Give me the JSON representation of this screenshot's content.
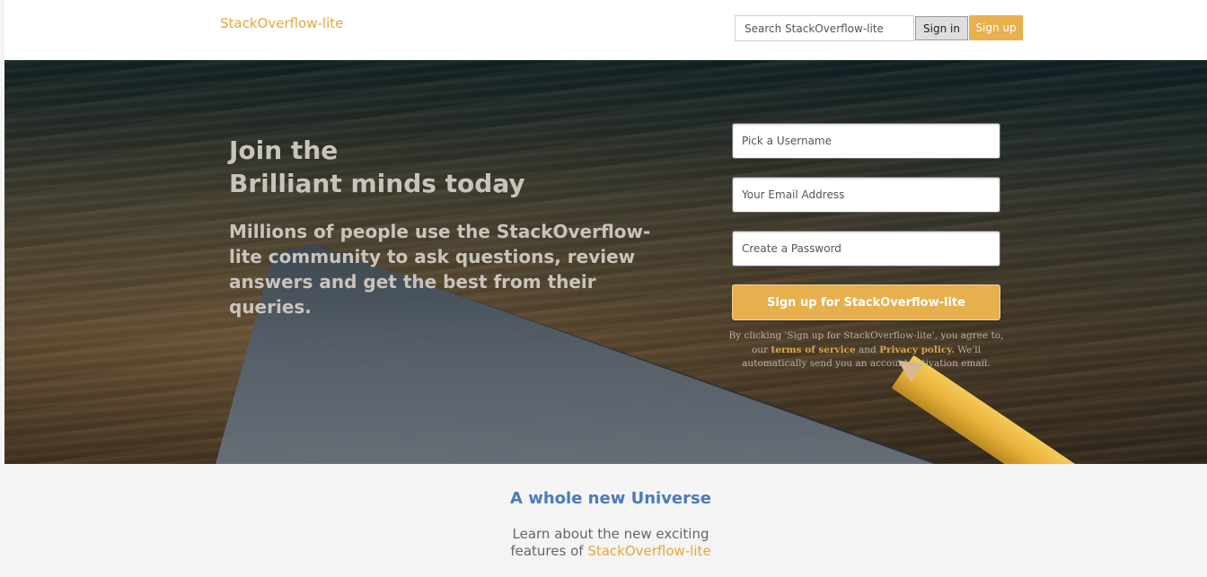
{
  "header": {
    "brand": "StackOverflow-lite",
    "search_placeholder": "Search StackOverflow-lite",
    "signin_label": "Sign in",
    "signup_label": "Sign up"
  },
  "hero": {
    "title_line1": "Join the",
    "title_line2": "Brilliant minds today",
    "description": "Millions of people use the StackOverflow-lite community to ask questions, review answers and get the best from their queries."
  },
  "signup_form": {
    "username_placeholder": "Pick a Username",
    "email_placeholder": "Your Email Address",
    "password_placeholder": "Create a Password",
    "submit_label": "Sign up for StackOverflow-lite",
    "terms_prefix": "By clicking 'Sign up for StackOverflow-lite', you agree to, our",
    "terms_link": "terms of service",
    "terms_and": "and",
    "privacy_link": "Privacy policy.",
    "terms_suffix": "We'll automatically send you an account activation email."
  },
  "features": {
    "title": "A whole new Universe",
    "text_line1": "Learn about the new exciting",
    "text_line2_prefix": "features of",
    "brand": "StackOverflow-lite"
  },
  "colors": {
    "accent": "#e8a53a",
    "button_accent": "#e6b04e",
    "features_title": "#4a7bbd",
    "page_background": "#f4f4f4"
  }
}
